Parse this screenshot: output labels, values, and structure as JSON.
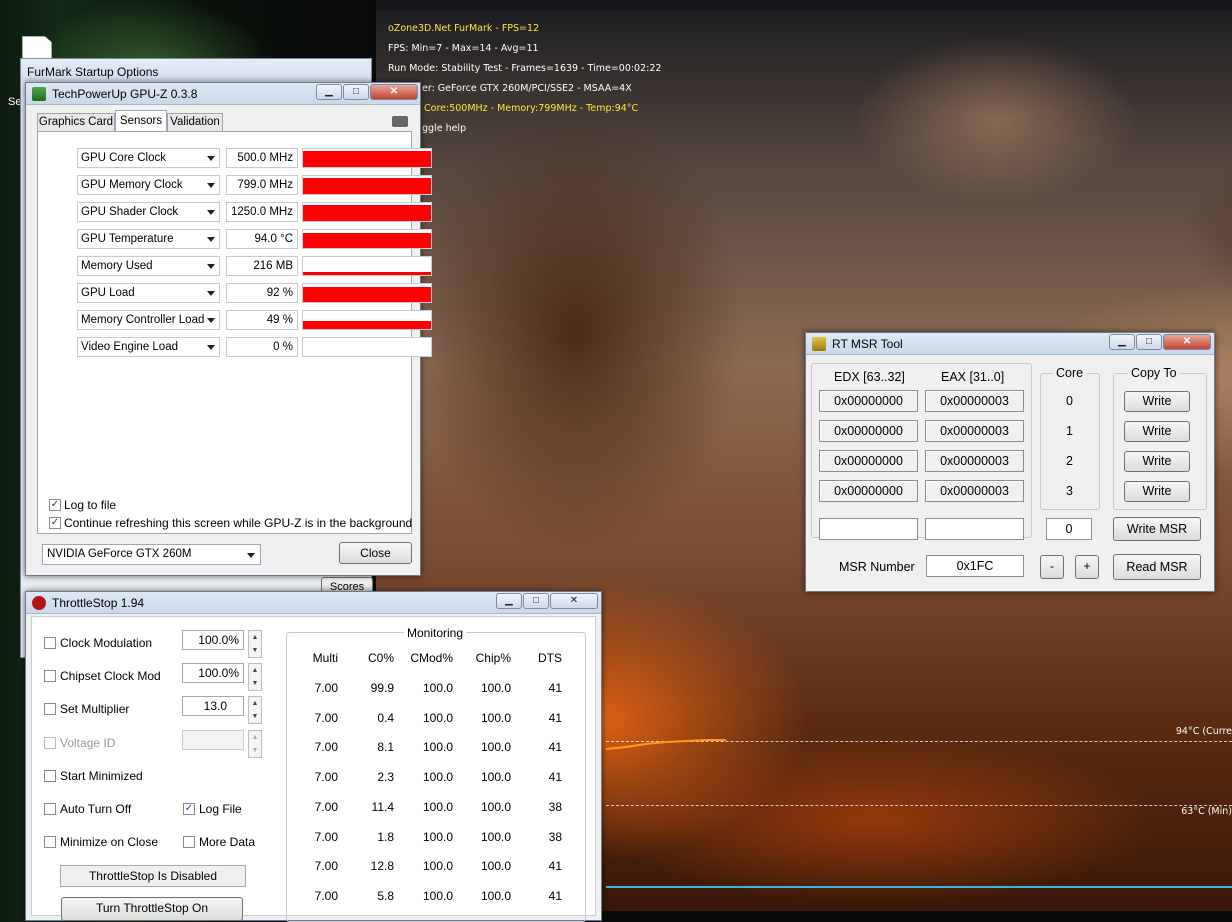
{
  "furmark": {
    "title_line": "oZone3D.Net FurMark - FPS=12",
    "fps_line": "FPS: Min=7 - Max=14 - Avg=11",
    "run_line": "Run Mode: Stability Test - Frames=1639 - Time=00:02:22",
    "renderer_line": "er: GeForce GTX 260M/PCI/SSE2 - MSAA=4X",
    "gpu_line": "Core:500MHz - Memory:799MHz - Temp:94°C",
    "help_line": "ggle help",
    "temp_current": "94°C (Curre",
    "temp_min": "63°C (Min)"
  },
  "startup": {
    "title": "FurMark Startup Options",
    "scores_label": "Scores",
    "side_label": "Se"
  },
  "gpuz": {
    "title": "TechPowerUp GPU-Z 0.3.8",
    "tabs": [
      "Graphics Card",
      "Sensors",
      "Validation"
    ],
    "sensors": [
      {
        "name": "GPU Core Clock",
        "value": "500.0 MHz",
        "level": 1.0
      },
      {
        "name": "GPU Memory Clock",
        "value": "799.0 MHz",
        "level": 1.0
      },
      {
        "name": "GPU Shader Clock",
        "value": "1250.0 MHz",
        "level": 1.0
      },
      {
        "name": "GPU Temperature",
        "value": "94.0 °C",
        "level": 0.94
      },
      {
        "name": "Memory Used",
        "value": "216 MB",
        "level": 0.2
      },
      {
        "name": "GPU Load",
        "value": "92 %",
        "level": 0.92
      },
      {
        "name": "Memory Controller Load",
        "value": "49 %",
        "level": 0.49
      },
      {
        "name": "Video Engine Load",
        "value": "0 %",
        "level": 0
      }
    ],
    "log_to_file": "Log to file",
    "continue_refresh": "Continue refreshing this screen while GPU-Z is in the background",
    "gpu_select": "NVIDIA GeForce GTX 260M",
    "close_label": "Close"
  },
  "throttlestop": {
    "title": "ThrottleStop 1.94",
    "options": [
      {
        "label": "Clock Modulation",
        "value": "100.0%",
        "checked": false,
        "enabled": true
      },
      {
        "label": "Chipset Clock Mod",
        "value": "100.0%",
        "checked": false,
        "enabled": true
      },
      {
        "label": "Set Multiplier",
        "value": "13.0",
        "checked": false,
        "enabled": true
      },
      {
        "label": "Voltage ID",
        "value": "",
        "checked": false,
        "enabled": false
      }
    ],
    "start_minimized": "Start Minimized",
    "auto_turn_off": "Auto Turn Off",
    "log_file": "Log File",
    "minimize_on_close": "Minimize on Close",
    "more_data": "More Data",
    "status": "ThrottleStop Is Disabled",
    "turn_on": "Turn ThrottleStop On",
    "monitoring_title": "Monitoring",
    "monitor_headers": [
      "Multi",
      "C0%",
      "CMod%",
      "Chip%",
      "DTS"
    ],
    "monitor_rows": [
      [
        "7.00",
        "99.9",
        "100.0",
        "100.0",
        "41"
      ],
      [
        "7.00",
        "0.4",
        "100.0",
        "100.0",
        "41"
      ],
      [
        "7.00",
        "8.1",
        "100.0",
        "100.0",
        "41"
      ],
      [
        "7.00",
        "2.3",
        "100.0",
        "100.0",
        "41"
      ],
      [
        "7.00",
        "11.4",
        "100.0",
        "100.0",
        "38"
      ],
      [
        "7.00",
        "1.8",
        "100.0",
        "100.0",
        "38"
      ],
      [
        "7.00",
        "12.8",
        "100.0",
        "100.0",
        "41"
      ],
      [
        "7.00",
        "5.8",
        "100.0",
        "100.0",
        "41"
      ]
    ]
  },
  "msr": {
    "title": "RT MSR Tool",
    "edx_header": "EDX [63..32]",
    "eax_header": "EAX [31..0]",
    "core_header": "Core",
    "copy_header": "Copy To",
    "rows": [
      {
        "edx": "0x00000000",
        "eax": "0x00000003",
        "core": "0"
      },
      {
        "edx": "0x00000000",
        "eax": "0x00000003",
        "core": "1"
      },
      {
        "edx": "0x00000000",
        "eax": "0x00000003",
        "core": "2"
      },
      {
        "edx": "0x00000000",
        "eax": "0x00000003",
        "core": "3"
      }
    ],
    "write_label": "Write",
    "core_input": "0",
    "write_msr": "Write MSR",
    "msr_number_label": "MSR Number",
    "msr_number": "0x1FC",
    "minus": "-",
    "plus": "+",
    "read_msr": "Read MSR"
  }
}
